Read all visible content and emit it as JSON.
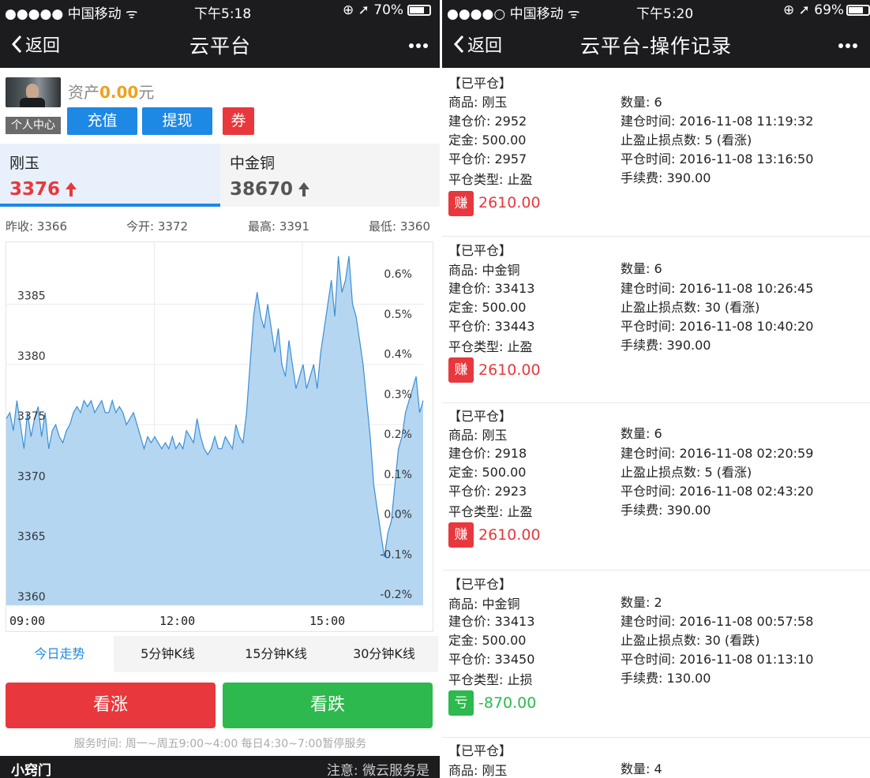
{
  "left": {
    "status": {
      "carrier": "●●●●● 中国移动 ᯤ",
      "time": "下午5:18",
      "battery": "⊕ ➚ 70%"
    },
    "nav": {
      "back": "返回",
      "title": "云平台"
    },
    "user": {
      "center": "个人中心",
      "asset_label": "资产",
      "asset_value": "0.00",
      "asset_unit": "元",
      "recharge": "充值",
      "withdraw": "提现",
      "coupon": "券"
    },
    "tabs": [
      {
        "name": "刚玉",
        "price": "3376",
        "trend": "up"
      },
      {
        "name": "中金铜",
        "price": "38670",
        "trend": "up"
      }
    ],
    "stats": {
      "prev_close": "昨收: 3366",
      "open": "今开: 3372",
      "high": "最高: 3391",
      "low": "最低: 3360"
    },
    "ktabs": [
      "今日走势",
      "5分钟K线",
      "15分钟K线",
      "30分钟K线"
    ],
    "buttons": {
      "up": "看涨",
      "down": "看跌"
    },
    "service": "服务时间: 周一~周五9:00~4:00 每日4:30~7:00暂停服务",
    "footer": {
      "brand": "小窍门",
      "note": "注意: 微云服务是"
    }
  },
  "right": {
    "status": {
      "carrier": "●●●●○ 中国移动 ᯤ",
      "time": "下午5:20",
      "battery": "⊕ ➚ 69%"
    },
    "nav": {
      "back": "返回",
      "title": "云平台-操作记录"
    },
    "records": [
      {
        "head": "【已平仓】",
        "product": "商品: 刚玉",
        "qty": "数量: 6",
        "open_price": "建仓价: 2952",
        "open_time": "建仓时间: 2016-11-08 11:19:32",
        "deposit": "定金: 500.00",
        "tp_sl": "止盈止损点数: 5 (看涨)",
        "close_price": "平仓价: 2957",
        "close_time": "平仓时间: 2016-11-08 13:16:50",
        "close_type": "平仓类型: 止盈",
        "fee": "手续费: 390.00",
        "badge": "赚",
        "pnl": "2610.00",
        "result": "win"
      },
      {
        "head": "【已平仓】",
        "product": "商品: 中金铜",
        "qty": "数量: 6",
        "open_price": "建仓价: 33413",
        "open_time": "建仓时间: 2016-11-08 10:26:45",
        "deposit": "定金: 500.00",
        "tp_sl": "止盈止损点数: 30 (看涨)",
        "close_price": "平仓价: 33443",
        "close_time": "平仓时间: 2016-11-08 10:40:20",
        "close_type": "平仓类型: 止盈",
        "fee": "手续费: 390.00",
        "badge": "赚",
        "pnl": "2610.00",
        "result": "win"
      },
      {
        "head": "【已平仓】",
        "product": "商品: 刚玉",
        "qty": "数量: 6",
        "open_price": "建仓价: 2918",
        "open_time": "建仓时间: 2016-11-08 02:20:59",
        "deposit": "定金: 500.00",
        "tp_sl": "止盈止损点数: 5 (看涨)",
        "close_price": "平仓价: 2923",
        "close_time": "平仓时间: 2016-11-08 02:43:20",
        "close_type": "平仓类型: 止盈",
        "fee": "手续费: 390.00",
        "badge": "赚",
        "pnl": "2610.00",
        "result": "win"
      },
      {
        "head": "【已平仓】",
        "product": "商品: 中金铜",
        "qty": "数量: 2",
        "open_price": "建仓价: 33413",
        "open_time": "建仓时间: 2016-11-08 00:57:58",
        "deposit": "定金: 500.00",
        "tp_sl": "止盈止损点数: 30 (看跌)",
        "close_price": "平仓价: 33450",
        "close_time": "平仓时间: 2016-11-08 01:13:10",
        "close_type": "平仓类型: 止损",
        "fee": "手续费: 130.00",
        "badge": "亏",
        "pnl": "-870.00",
        "result": "loss"
      },
      {
        "head": "【已平仓】",
        "product": "商品: 刚玉",
        "qty": "数量: 4"
      }
    ]
  },
  "chart_data": {
    "type": "area",
    "x_ticks": [
      "09:00",
      "12:00",
      "15:00"
    ],
    "y_ticks": [
      3360,
      3365,
      3370,
      3375,
      3380,
      3385
    ],
    "y_right_ticks": [
      "-0.2%",
      "-0.1%",
      "0.0%",
      "0.1%",
      "0.2%",
      "0.3%",
      "0.4%",
      "0.5%",
      "0.6%"
    ],
    "ylim": [
      3360,
      3389.5
    ],
    "series": [
      {
        "values": [
          3375.5,
          3376,
          3374.5,
          3377,
          3375,
          3373,
          3376,
          3374,
          3375.5,
          3376.5,
          3374,
          3376,
          3373,
          3374.5,
          3375,
          3374,
          3373.5,
          3374.5,
          3375,
          3376,
          3376.5,
          3376,
          3377,
          3376.5,
          3377,
          3376,
          3376.5,
          3377,
          3376,
          3376,
          3377,
          3376,
          3376.5,
          3376,
          3375,
          3375.5,
          3376,
          3375,
          3374,
          3373,
          3374,
          3373.5,
          3374,
          3373.5,
          3373,
          3373.5,
          3373,
          3374,
          3373,
          3373.5,
          3373,
          3374.5,
          3374,
          3373.5,
          3375.5,
          3374,
          3373,
          3372.5,
          3373,
          3374,
          3373,
          3373,
          3374,
          3373.5,
          3373,
          3375,
          3374,
          3373.5,
          3376,
          3380,
          3384,
          3386,
          3384,
          3383,
          3385,
          3383,
          3381,
          3383,
          3380,
          3379,
          3382,
          3380,
          3378,
          3379,
          3380,
          3378,
          3379,
          3380,
          3378,
          3381,
          3383,
          3385,
          3387,
          3384,
          3389,
          3386,
          3387,
          3389,
          3385,
          3384,
          3382,
          3380,
          3377,
          3374,
          3370,
          3368,
          3366,
          3364,
          3366,
          3367,
          3370,
          3373,
          3374,
          3376,
          3377,
          3378,
          3379,
          3376,
          3377
        ]
      }
    ]
  }
}
